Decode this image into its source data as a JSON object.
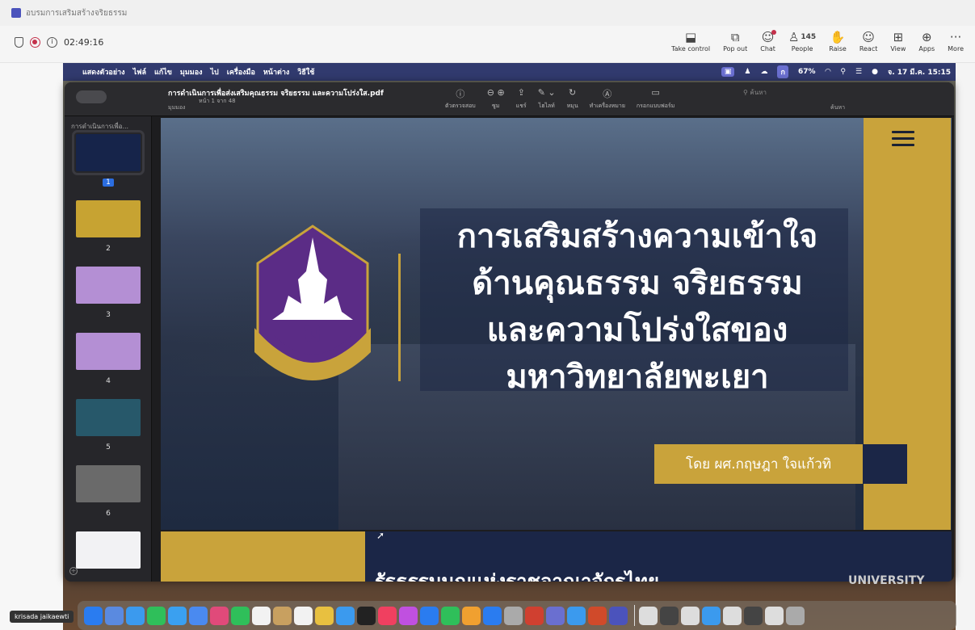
{
  "window": {
    "title": "อบรมการเสริมสร้างจริยธรรม"
  },
  "call": {
    "timer": "02:49:16"
  },
  "toolbar": [
    {
      "id": "take-control",
      "label": "Take control",
      "icon": "⬓"
    },
    {
      "id": "pop-out",
      "label": "Pop out",
      "icon": "⧉"
    },
    {
      "id": "chat",
      "label": "Chat",
      "icon": "☺"
    },
    {
      "id": "people",
      "label": "People",
      "icon": "♙",
      "count": "145"
    },
    {
      "id": "raise",
      "label": "Raise",
      "icon": "✋"
    },
    {
      "id": "react",
      "label": "React",
      "icon": "☺"
    },
    {
      "id": "view",
      "label": "View",
      "icon": "⊞"
    },
    {
      "id": "apps",
      "label": "Apps",
      "icon": "⊕"
    },
    {
      "id": "more",
      "label": "More",
      "icon": "···"
    }
  ],
  "mac_menubar": {
    "items": [
      "แสดงตัวอย่าง",
      "ไฟล์",
      "แก้ไข",
      "มุมมอง",
      "ไป",
      "เครื่องมือ",
      "หน้าต่าง",
      "วิธีใช้"
    ],
    "battery": "67%",
    "datetime": "จ. 17 มี.ค. 15:15"
  },
  "preview": {
    "filename": "การดำเนินการเพื่อส่งเสริมคุณธรรม จริยธรรม และความโปร่งใส.pdf",
    "page_info": "หน้า 1 จาก 48",
    "view_label": "มุมมอง",
    "tools": [
      {
        "icon": "ⓘ",
        "label": "ตัวตรวจสอบ"
      },
      {
        "icon": "⊖ ⊕",
        "label": "ซูม"
      },
      {
        "icon": "⇪",
        "label": "แชร์"
      },
      {
        "icon": "✎ ⌄",
        "label": "ไฮไลท์"
      },
      {
        "icon": "↻",
        "label": "หมุน"
      },
      {
        "icon": "Ⓐ",
        "label": "ทำเครื่องหมาย"
      },
      {
        "icon": "▭",
        "label": "กรอกแบบฟอร์ม"
      }
    ],
    "search_placeholder": "ค้นหา",
    "search_label": "ค้นหา",
    "sidebar_title": "การดำเนินการเพื่อ...",
    "thumb_pages": [
      "1",
      "2",
      "3",
      "4",
      "5",
      "6"
    ]
  },
  "slide": {
    "title_lines": [
      "การเสริมสร้างความเข้าใจ",
      "ด้านคุณธรรม จริยธรรม",
      "และความโปร่งใสของ",
      "มหาวิทยาลัยพะเยา"
    ],
    "byline": "โดย ผศ.กฤษฎา ใจแก้วทิ",
    "crest_text": "มหาวิทยาลัยพะเยา",
    "crest_sub": "UNIVERSITY OF PHAYAO"
  },
  "slide2": {
    "heading": "รัฐธรรมนูญแห่งราชอาณาจักรไทย"
  },
  "background": {
    "university_label": "UNIVERSITY"
  },
  "participant": {
    "name": "krisada jaikaewti"
  },
  "colors": {
    "gold": "#c9a33b",
    "navy": "#1b2647",
    "purple": "#5b2c86"
  }
}
